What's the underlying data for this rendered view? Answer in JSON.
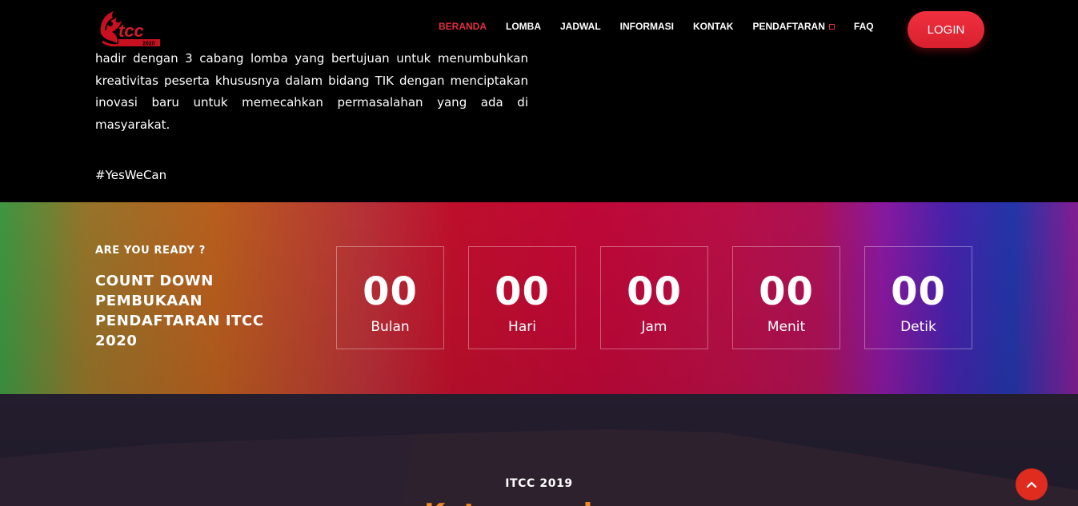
{
  "brand": {
    "logo_text": "ITCC",
    "logo_year": "2020"
  },
  "nav": {
    "items": [
      {
        "label": "BERANDA",
        "active": true
      },
      {
        "label": "LOMBA",
        "active": false
      },
      {
        "label": "JADWAL",
        "active": false
      },
      {
        "label": "INFORMASI",
        "active": false
      },
      {
        "label": "KONTAK",
        "active": false
      },
      {
        "label": "PENDAFTARAN",
        "active": false,
        "has_dropdown": true
      },
      {
        "label": "FAQ",
        "active": false
      }
    ],
    "login_label": "LOGIN"
  },
  "intro": {
    "lines": [
      "hadir dengan 3 cabang lomba yang bertujuan untuk menumbuhkan",
      "kreativitas peserta khususnya dalam bidang TIK dengan menciptakan",
      "inovasi baru untuk memecahkan permasalahan yang ada di masyarakat."
    ],
    "hashtag": "#YesWeCan"
  },
  "countdown": {
    "kicker": "ARE YOU READY ?",
    "title": "COUNT DOWN PEMBUKAAN PENDAFTARAN ITCC 2020",
    "units": [
      {
        "value": "00",
        "label": "Bulan"
      },
      {
        "value": "00",
        "label": "Hari"
      },
      {
        "value": "00",
        "label": "Jam"
      },
      {
        "value": "00",
        "label": "Menit"
      },
      {
        "value": "00",
        "label": "Detik"
      }
    ]
  },
  "section": {
    "kicker": "ITCC 2019",
    "heading": "Kata mereka ..."
  },
  "icons": {
    "scroll_top": "chevron-up-icon"
  },
  "colors": {
    "accent_red": "#e0303f",
    "orange_heading": "#f08a24"
  }
}
